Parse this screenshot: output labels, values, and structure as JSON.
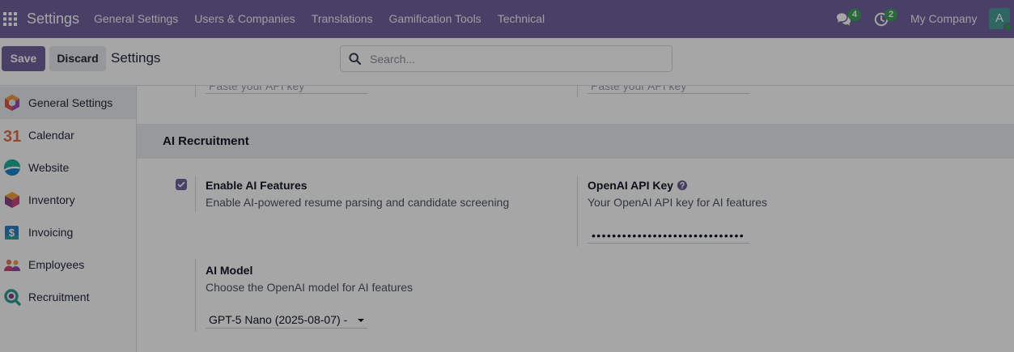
{
  "navbar": {
    "app_name": "Settings",
    "menu": [
      "General Settings",
      "Users & Companies",
      "Translations",
      "Gamification Tools",
      "Technical"
    ],
    "apps_icon": "grid-icon",
    "messages_icon": "chat-icon",
    "messages_badge": "4",
    "activities_icon": "clock-icon",
    "activities_badge": "2",
    "company": "My Company",
    "avatar_initial": "A"
  },
  "control_panel": {
    "save_label": "Save",
    "discard_label": "Discard",
    "breadcrumb": "Settings",
    "search_icon": "search-icon",
    "search_placeholder": "Search...",
    "search_value": ""
  },
  "sidebar": {
    "items": [
      {
        "label": "General Settings",
        "icon": "general-settings-icon",
        "active": true
      },
      {
        "label": "Calendar",
        "icon": "calendar-icon",
        "icon_text": "31",
        "active": false
      },
      {
        "label": "Website",
        "icon": "website-icon",
        "active": false
      },
      {
        "label": "Inventory",
        "icon": "inventory-icon",
        "active": false
      },
      {
        "label": "Invoicing",
        "icon": "invoicing-icon",
        "icon_text": "$",
        "active": false
      },
      {
        "label": "Employees",
        "icon": "employees-icon",
        "active": false
      },
      {
        "label": "Recruitment",
        "icon": "recruitment-icon",
        "active": false
      }
    ]
  },
  "main": {
    "previous_section": {
      "fields": [
        {
          "placeholder": "Paste your API key"
        },
        {
          "placeholder": "Paste your API key"
        }
      ]
    },
    "ai_section": {
      "title": "AI Recruitment",
      "enable_ai": {
        "label": "Enable AI Features",
        "description": "Enable AI-powered resume parsing and candidate screening",
        "checked": true
      },
      "api_key": {
        "label": "OpenAI API Key",
        "help_icon": "question-circle-icon",
        "description": "Your OpenAI API key for AI features",
        "value_masked": "••••••••••••••••••••••••••••••"
      },
      "ai_model": {
        "label": "AI Model",
        "description": "Choose the OpenAI model for AI features",
        "selected": "GPT-5 Nano (2025-08-07) -"
      }
    }
  },
  "colors": {
    "brand": "#71639e",
    "badge": "#3ea157",
    "avatar": "#4a9d97",
    "section_band": "#e9ecef",
    "backdrop": "rgba(0,0,0,0.35)"
  }
}
